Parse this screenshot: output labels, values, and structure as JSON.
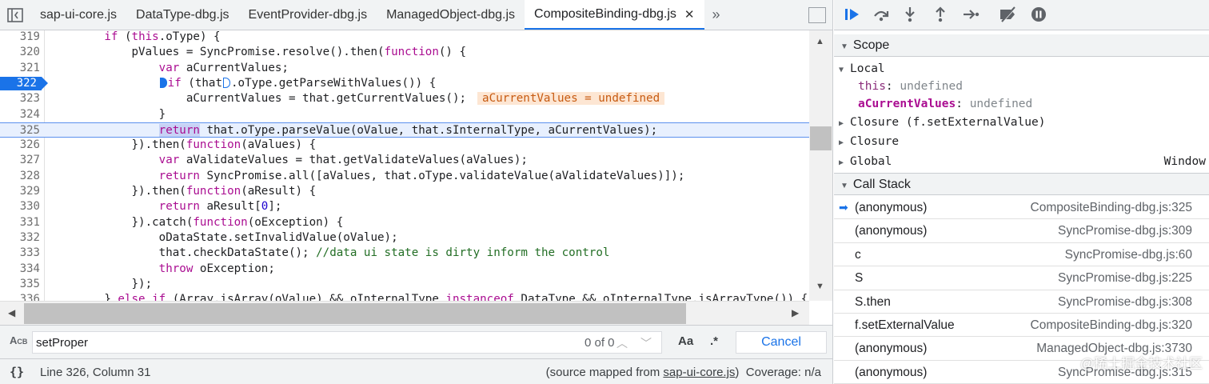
{
  "tabs": [
    {
      "label": "sap-ui-core.js"
    },
    {
      "label": "DataType-dbg.js"
    },
    {
      "label": "EventProvider-dbg.js"
    },
    {
      "label": "ManagedObject-dbg.js"
    },
    {
      "label": "CompositeBinding-dbg.js",
      "active": true
    }
  ],
  "tab_close": "✕",
  "tab_more": "»",
  "code_lines": [
    {
      "n": "319",
      "html": "        <span class='kw'>if</span> (<span class='kw'>this</span>.oType) {"
    },
    {
      "n": "320",
      "html": "            pValues = SyncPromise.resolve().then(<span class='kw'>function</span>() {"
    },
    {
      "n": "321",
      "html": "                <span class='kw'>var</span> aCurrentValues;"
    },
    {
      "n": "322",
      "bp": true,
      "html": "                <span class='mk fill'></span><span class='kw'>if</span> (that<span class='mk'></span>.oType.getParseWithValues()) {"
    },
    {
      "n": "323",
      "html": "                    aCurrentValues = that.getCurrentValues();<span class='inline-val'>aCurrentValues = undefined</span>"
    },
    {
      "n": "324",
      "html": "                }"
    },
    {
      "n": "325",
      "cur": true,
      "html": "                <span class='kw hl-ret'>return</span> that.oType.parseValue(oValue, that.sInternalType, aCurrentValues);"
    },
    {
      "n": "326",
      "html": "            }).then(<span class='kw'>function</span>(aValues) {"
    },
    {
      "n": "327",
      "html": "                <span class='kw'>var</span> aValidateValues = that.getValidateValues(aValues);"
    },
    {
      "n": "328",
      "html": "                <span class='kw'>return</span> SyncPromise.all([aValues, that.oType.validateValue(aValidateValues)]);"
    },
    {
      "n": "329",
      "html": "            }).then(<span class='kw'>function</span>(aResult) {"
    },
    {
      "n": "330",
      "html": "                <span class='kw'>return</span> aResult[<span class='num'>0</span>];"
    },
    {
      "n": "331",
      "html": "            }).catch(<span class='kw'>function</span>(oException) {"
    },
    {
      "n": "332",
      "html": "                oDataState.setInvalidValue(oValue);"
    },
    {
      "n": "333",
      "html": "                that.checkDataState(); <span class='cm'>//data ui state is dirty inform the control</span>"
    },
    {
      "n": "334",
      "html": "                <span class='kw'>throw</span> oException;"
    },
    {
      "n": "335",
      "html": "            });"
    },
    {
      "n": "336",
      "html": "        } <span class='kw'>else if</span> (Array.isArray(oValue) &amp;&amp; oInternalType <span class='kw'>instanceof</span> DataType &amp;&amp; oInternalType.isArrayType()) {"
    }
  ],
  "search": {
    "value": "setProper",
    "count": "0 of 0",
    "match_case": "Aa",
    "regex": ".*",
    "cancel": "Cancel"
  },
  "status": {
    "braces": "{}",
    "position": "Line 326, Column 31",
    "mapped_prefix": "(source mapped from ",
    "mapped_file": "sap-ui-core.js",
    "mapped_suffix": ")",
    "coverage": "Coverage: n/a"
  },
  "scope": {
    "title": "Scope",
    "local_label": "Local",
    "this_key": "this",
    "this_val": "undefined",
    "cur_key": "aCurrentValues",
    "cur_val": "undefined",
    "closure1": "Closure (f.setExternalValue)",
    "closure2": "Closure",
    "global": "Global",
    "global_val": "Window"
  },
  "call_stack": {
    "title": "Call Stack",
    "frames": [
      {
        "fn": "(anonymous)",
        "loc": "CompositeBinding-dbg.js:325"
      },
      {
        "fn": "(anonymous)",
        "loc": "SyncPromise-dbg.js:309"
      },
      {
        "fn": "c",
        "loc": "SyncPromise-dbg.js:60"
      },
      {
        "fn": "S",
        "loc": "SyncPromise-dbg.js:225"
      },
      {
        "fn": "S.then",
        "loc": "SyncPromise-dbg.js:308"
      },
      {
        "fn": "f.setExternalValue",
        "loc": "CompositeBinding-dbg.js:320"
      },
      {
        "fn": "(anonymous)",
        "loc": "ManagedObject-dbg.js:3730"
      },
      {
        "fn": "(anonymous)",
        "loc": "SyncPromise-dbg.js:315"
      }
    ]
  },
  "watermark": "@稀土掘金技术社区"
}
